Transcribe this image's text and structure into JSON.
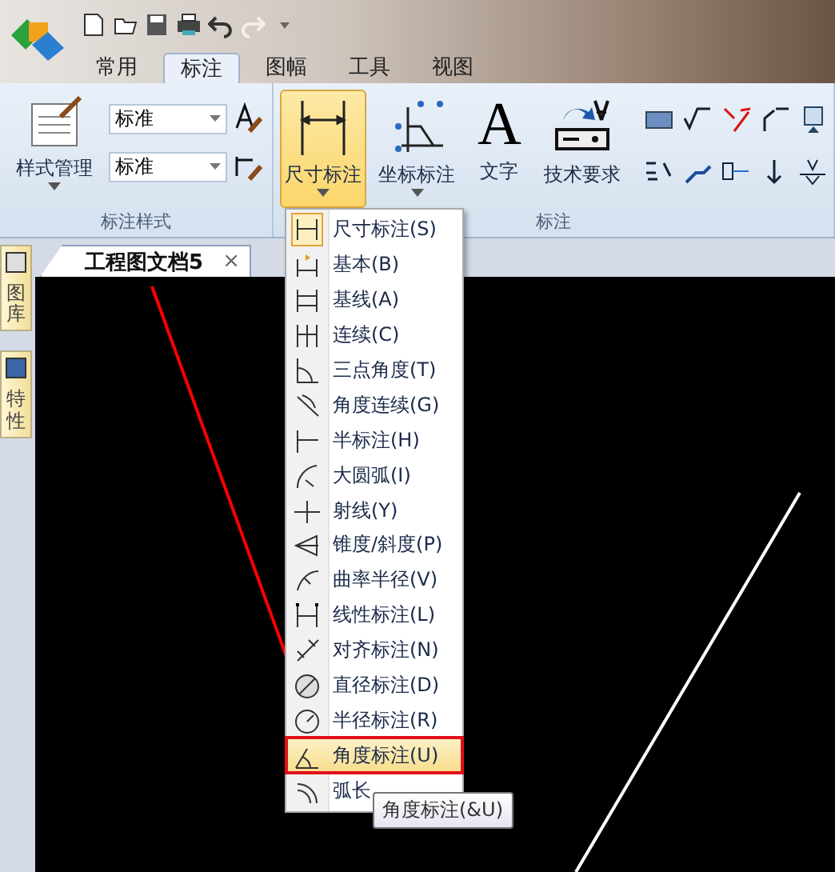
{
  "tabs": [
    {
      "label": "常用",
      "selected": false
    },
    {
      "label": "标注",
      "selected": true
    },
    {
      "label": "图幅",
      "selected": false
    },
    {
      "label": "工具",
      "selected": false
    },
    {
      "label": "视图",
      "selected": false
    }
  ],
  "ribbon": {
    "style_group": {
      "label": "标注样式",
      "manager_button": "样式管理",
      "dropdowns": [
        {
          "value": "标准"
        },
        {
          "value": "标准"
        }
      ]
    },
    "dimension_group": {
      "label": "标注",
      "buttons": [
        {
          "label": "尺寸标注",
          "kind": "dimension",
          "active": true,
          "has_menu": true
        },
        {
          "label": "坐标标注",
          "kind": "coordinate",
          "active": false,
          "has_menu": true
        },
        {
          "label": "文字",
          "kind": "glyph",
          "glyph": "A",
          "active": false,
          "has_menu": false
        },
        {
          "label": "技术要求",
          "kind": "requirement",
          "active": false,
          "has_menu": false
        }
      ]
    }
  },
  "side_tabs": [
    {
      "label": "图库"
    },
    {
      "label": "特性"
    }
  ],
  "document_tab": {
    "title": "工程图文档5",
    "close": "×"
  },
  "dropdown_menu": {
    "items": [
      {
        "label": "尺寸标注(S)",
        "current": true,
        "highlighted": false
      },
      {
        "label": "基本(B)",
        "current": false,
        "highlighted": false
      },
      {
        "label": "基线(A)",
        "current": false,
        "highlighted": false
      },
      {
        "label": "连续(C)",
        "current": false,
        "highlighted": false
      },
      {
        "label": "三点角度(T)",
        "current": false,
        "highlighted": false
      },
      {
        "label": "角度连续(G)",
        "current": false,
        "highlighted": false
      },
      {
        "label": "半标注(H)",
        "current": false,
        "highlighted": false
      },
      {
        "label": "大圆弧(I)",
        "current": false,
        "highlighted": false
      },
      {
        "label": "射线(Y)",
        "current": false,
        "highlighted": false
      },
      {
        "label": "锥度/斜度(P)",
        "current": false,
        "highlighted": false
      },
      {
        "label": "曲率半径(V)",
        "current": false,
        "highlighted": false
      },
      {
        "label": "线性标注(L)",
        "current": false,
        "highlighted": false
      },
      {
        "label": "对齐标注(N)",
        "current": false,
        "highlighted": false
      },
      {
        "label": "直径标注(D)",
        "current": false,
        "highlighted": false
      },
      {
        "label": "半径标注(R)",
        "current": false,
        "highlighted": false
      },
      {
        "label": "角度标注(U)",
        "current": false,
        "highlighted": true
      },
      {
        "label": "弧长",
        "current": false,
        "highlighted": false
      }
    ]
  },
  "tooltip": "角度标注(&U)"
}
